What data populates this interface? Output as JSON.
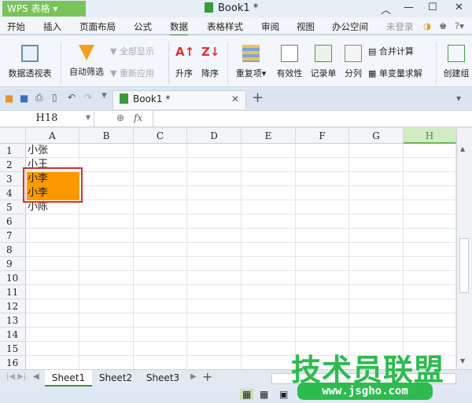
{
  "app": {
    "name": "WPS 表格",
    "title": "Book1 *"
  },
  "menu": [
    "开始",
    "插入",
    "页面布局",
    "公式",
    "数据",
    "表格样式",
    "审阅",
    "视图",
    "办公空间"
  ],
  "menu_active": "数据",
  "user": "未登录",
  "ribbon": {
    "pivot": "数据透视表",
    "autofilter": "自动筛选",
    "show_all": "全部显示",
    "reapply": "重新应用",
    "sort_asc": "升序",
    "sort_desc": "降序",
    "duplicates": "重复项",
    "validity": "有效性",
    "record": "记录单",
    "split": "分列",
    "consolidate": "合并计算",
    "goal_seek": "单变量求解",
    "create": "创建组"
  },
  "doc_tab": "Book1 *",
  "formula": {
    "name_box": "H18",
    "fx": "fx",
    "value": ""
  },
  "columns": [
    "A",
    "B",
    "C",
    "D",
    "E",
    "F",
    "G",
    "H"
  ],
  "selected_column": "H",
  "rows": [
    "1",
    "2",
    "3",
    "4",
    "5",
    "6",
    "7",
    "8",
    "9",
    "10",
    "11",
    "12",
    "13",
    "14",
    "15",
    "16"
  ],
  "cells": {
    "A1": "小张",
    "A2": "小王",
    "A3": "小李",
    "A4": "小李",
    "A5": "小陈"
  },
  "highlight_color": "#ff9900",
  "sheets": [
    "Sheet1",
    "Sheet2",
    "Sheet3"
  ],
  "active_sheet": "Sheet1",
  "watermark": {
    "text": "技术员联盟",
    "url": "www.jsgho.com"
  }
}
